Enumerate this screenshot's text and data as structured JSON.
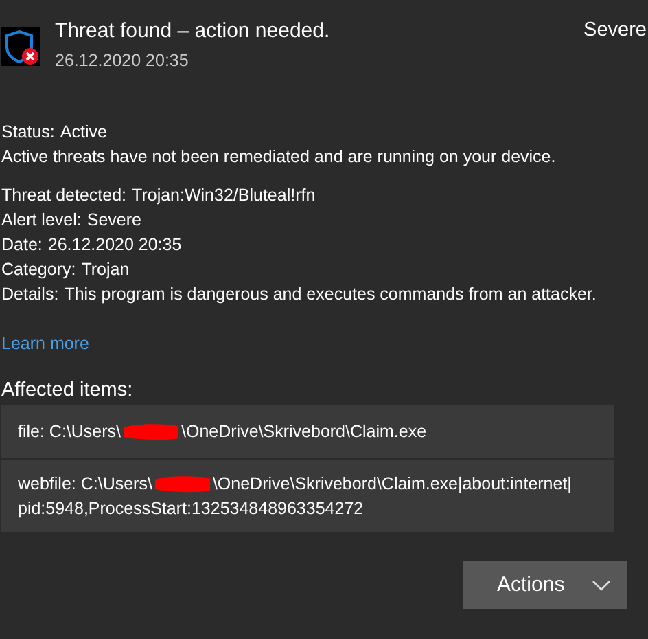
{
  "header": {
    "title": "Threat found – action needed.",
    "timestamp": "26.12.2020 20:35",
    "severity": "Severe"
  },
  "status": [
    {
      "label": "Status:",
      "value": "Active"
    }
  ],
  "status_message": "Active threats have not been remediated and are running on your device.",
  "details": [
    {
      "label": "Threat detected:",
      "value": "Trojan:Win32/Bluteal!rfn"
    },
    {
      "label": "Alert level:",
      "value": "Severe"
    },
    {
      "label": "Date:",
      "value": "26.12.2020 20:35"
    },
    {
      "label": "Category:",
      "value": "Trojan"
    },
    {
      "label": "Details:",
      "value": "This program is dangerous and executes commands from an attacker."
    }
  ],
  "learn_more": "Learn more",
  "affected_heading": "Affected items:",
  "affected_items": [
    {
      "prefix": "file: C:\\Users\\",
      "suffix": "\\OneDrive\\Skrivebord\\Claim.exe"
    },
    {
      "prefix": "webfile: C:\\Users\\",
      "suffix": "\\OneDrive\\Skrivebord\\Claim.exe|about:internet|",
      "continuation": "pid:5948,ProcessStart:132534848963354272"
    }
  ],
  "actions_button": "Actions"
}
